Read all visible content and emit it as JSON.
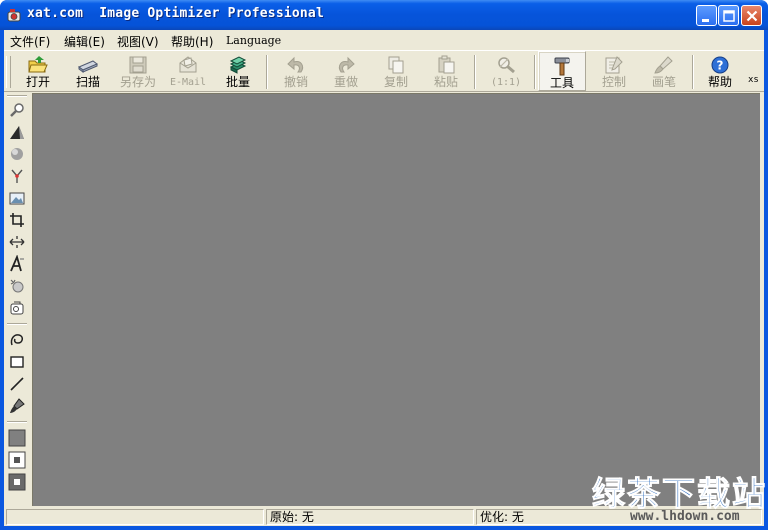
{
  "window": {
    "title": "xat.com  Image Optimizer Professional"
  },
  "menu": [
    {
      "label": "文件(F)"
    },
    {
      "label": "编辑(E)"
    },
    {
      "label": "视图(V)"
    },
    {
      "label": "帮助(H)"
    },
    {
      "label": "Language"
    }
  ],
  "toolbar": {
    "open": "打开",
    "scan": "扫描",
    "save_as": "另存为",
    "email": "E-Mail",
    "batch": "批量",
    "undo": "撤销",
    "redo": "重做",
    "copy": "复制",
    "paste": "粘贴",
    "zoom": "(1:1)",
    "tools": "工具",
    "control": "控制",
    "brush": "画笔",
    "help": "帮助",
    "xs": "xs"
  },
  "status": {
    "empty": "",
    "original": "原始: 无",
    "optimized": "优化: 无"
  },
  "watermark": {
    "brand": "绿茶下载站",
    "url": "www.lhdown.com"
  },
  "colors": {
    "titlebar": "#0654da",
    "workspace": "#808080",
    "chrome": "#ece9d8"
  }
}
